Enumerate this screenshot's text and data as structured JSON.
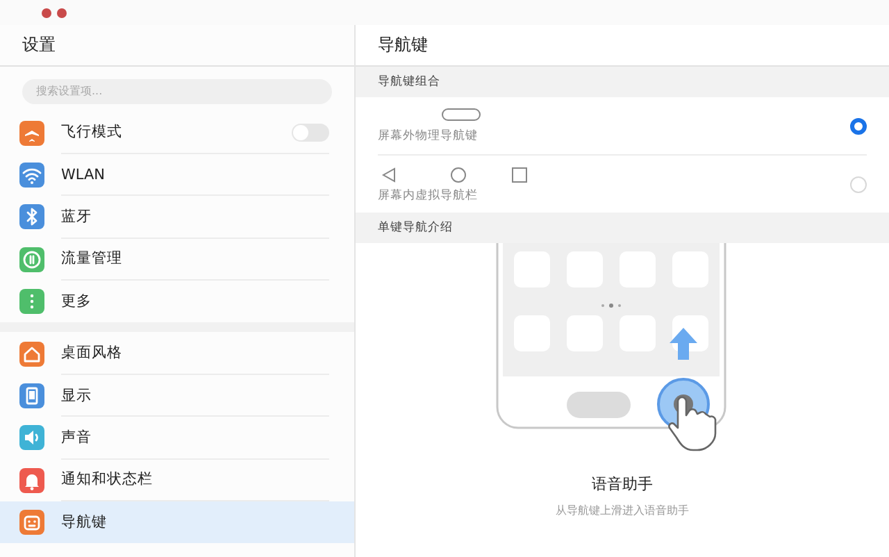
{
  "sidebar": {
    "title": "设置",
    "search": {
      "placeholder": "搜索设置项..."
    },
    "groups": [
      {
        "items": [
          {
            "label": "飞行模式",
            "color": "#ee7a36",
            "kind": "toggle",
            "on": false,
            "selected": false
          },
          {
            "label": "WLAN",
            "color": "#4a8fdc",
            "kind": "link",
            "selected": false
          },
          {
            "label": "蓝牙",
            "color": "#4a8fdc",
            "kind": "link",
            "selected": false
          },
          {
            "label": "流量管理",
            "color": "#4fbe6b",
            "kind": "link",
            "selected": false
          },
          {
            "label": "更多",
            "color": "#4fbe6b",
            "kind": "link",
            "selected": false
          }
        ]
      },
      {
        "items": [
          {
            "label": "桌面风格",
            "color": "#ee7a36",
            "kind": "link",
            "selected": false
          },
          {
            "label": "显示",
            "color": "#4a8fdc",
            "kind": "link",
            "selected": false
          },
          {
            "label": "声音",
            "color": "#3fb3d6",
            "kind": "link",
            "selected": false
          },
          {
            "label": "通知和状态栏",
            "color": "#ee5a4f",
            "kind": "link",
            "selected": false
          },
          {
            "label": "导航键",
            "color": "#ee7a36",
            "kind": "link",
            "selected": true
          }
        ]
      }
    ]
  },
  "panel": {
    "title": "导航键",
    "sections": [
      {
        "header": "导航键组合",
        "options": [
          {
            "kind": "physical",
            "label": "屏幕外物理导航键",
            "selected": true
          },
          {
            "kind": "virtual",
            "label": "屏幕内虚拟导航栏",
            "selected": false
          }
        ]
      },
      {
        "header": "单键导航介绍",
        "illustration": {
          "title": "语音助手",
          "caption": "从导航键上滑进入语音助手"
        }
      }
    ]
  }
}
